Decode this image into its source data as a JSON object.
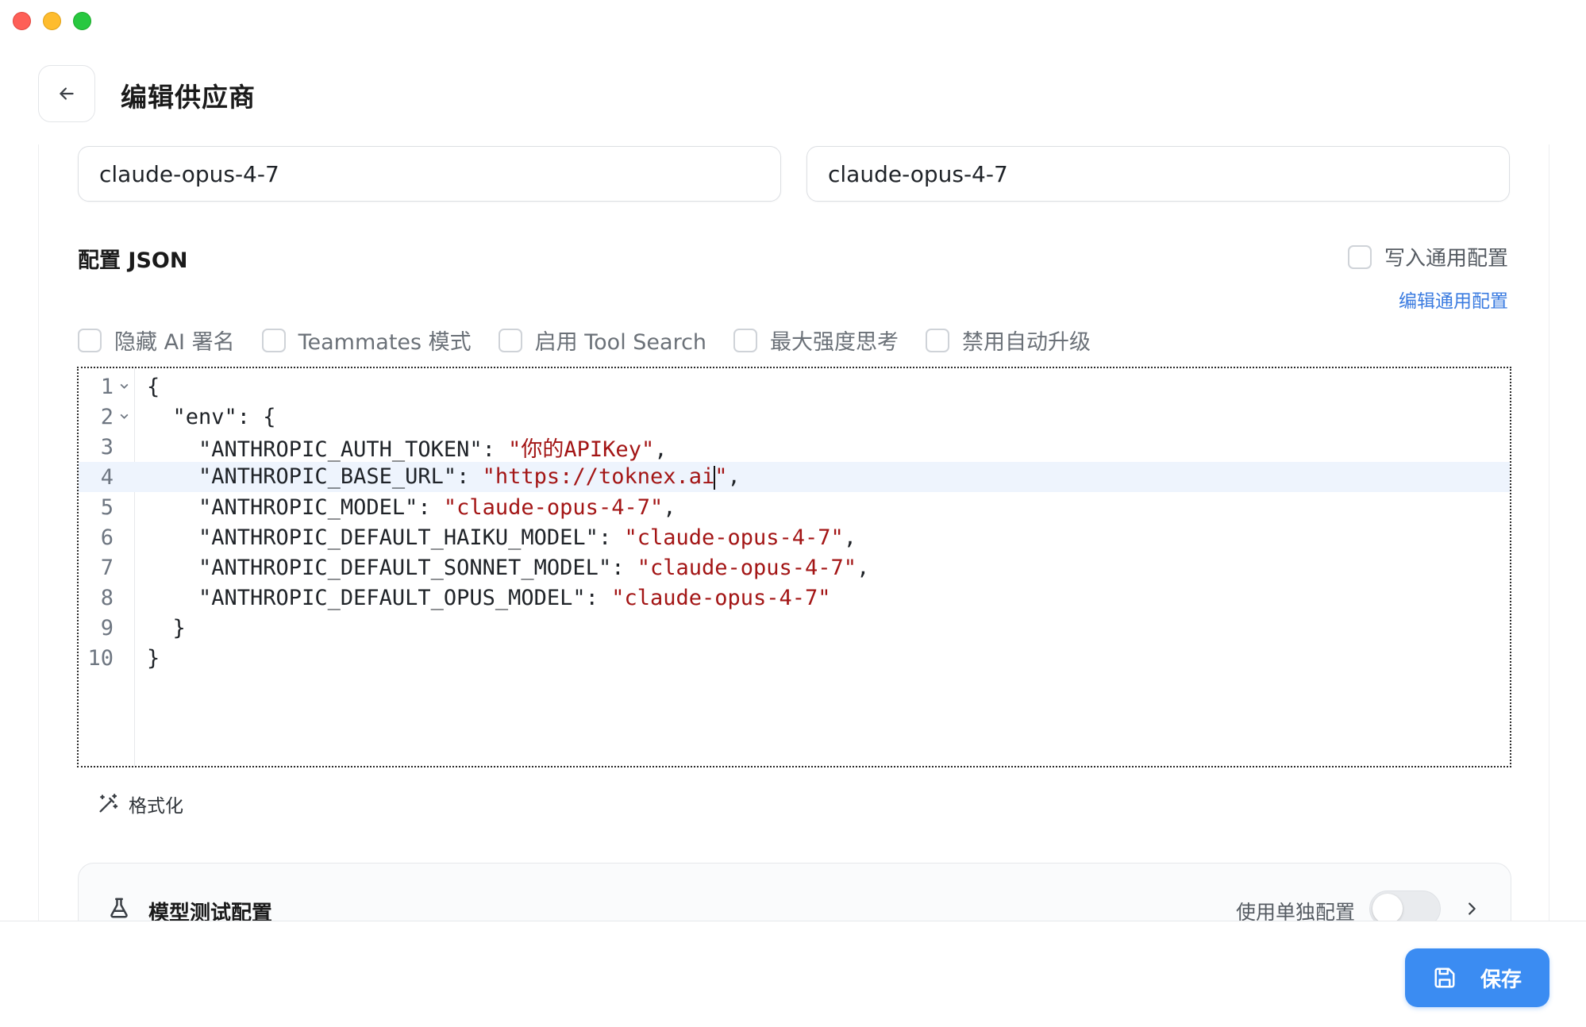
{
  "header": {
    "title": "编辑供应商",
    "back_icon": "arrow-left-icon"
  },
  "fields": {
    "model_left": "claude-opus-4-7",
    "model_right": "claude-opus-4-7"
  },
  "config": {
    "section_label": "配置 JSON",
    "write_common_label": "写入通用配置",
    "edit_common_link": "编辑通用配置",
    "options": [
      {
        "label": "隐藏 AI 署名",
        "checked": false
      },
      {
        "label": "Teammates 模式",
        "checked": false
      },
      {
        "label": "启用 Tool Search",
        "checked": false
      },
      {
        "label": "最大强度思考",
        "checked": false
      },
      {
        "label": "禁用自动升级",
        "checked": false
      }
    ]
  },
  "editor": {
    "active_line": 4,
    "lines": [
      {
        "num": "1",
        "key": "{",
        "value": "",
        "tail": ""
      },
      {
        "num": "2",
        "key": "  \"env\": {",
        "value": "",
        "tail": ""
      },
      {
        "num": "3",
        "key": "    \"ANTHROPIC_AUTH_TOKEN\": ",
        "value": "\"你的APIKey\"",
        "tail": ","
      },
      {
        "num": "4",
        "key": "    \"ANTHROPIC_BASE_URL\": ",
        "value": "\"https://toknex.ai\"",
        "tail": ","
      },
      {
        "num": "5",
        "key": "    \"ANTHROPIC_MODEL\": ",
        "value": "\"claude-opus-4-7\"",
        "tail": ","
      },
      {
        "num": "6",
        "key": "    \"ANTHROPIC_DEFAULT_HAIKU_MODEL\": ",
        "value": "\"claude-opus-4-7\"",
        "tail": ","
      },
      {
        "num": "7",
        "key": "    \"ANTHROPIC_DEFAULT_SONNET_MODEL\": ",
        "value": "\"claude-opus-4-7\"",
        "tail": ","
      },
      {
        "num": "8",
        "key": "    \"ANTHROPIC_DEFAULT_OPUS_MODEL\": ",
        "value": "\"claude-opus-4-7\"",
        "tail": ""
      },
      {
        "num": "9",
        "key": "  }",
        "value": "",
        "tail": ""
      },
      {
        "num": "10",
        "key": "}",
        "value": "",
        "tail": ""
      }
    ],
    "format_label": "格式化"
  },
  "model_test": {
    "title": "模型测试配置",
    "use_single_label": "使用单独配置",
    "use_single_enabled": false
  },
  "footer": {
    "save_label": "保存"
  }
}
